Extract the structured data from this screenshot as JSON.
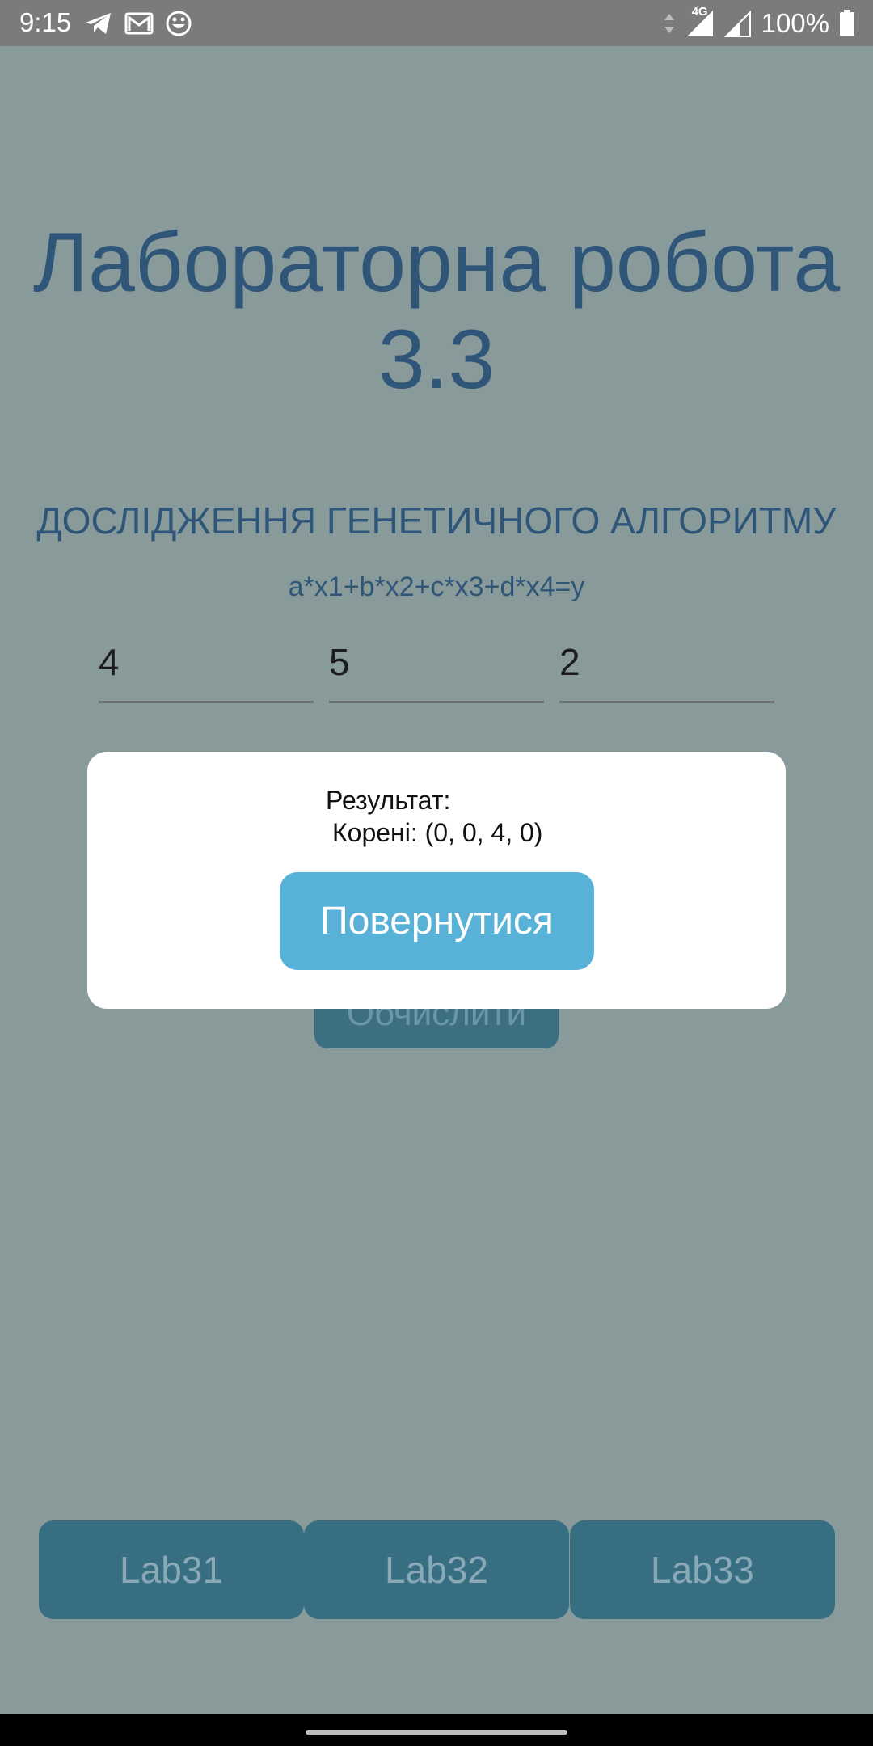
{
  "status_bar": {
    "time": "9:15",
    "network": "4G",
    "battery": "100%",
    "icons": [
      "telegram-icon",
      "gmail-icon",
      "emoji-app-icon",
      "data-arrows-icon",
      "signal-icon",
      "signal-icon",
      "battery-icon"
    ]
  },
  "screen": {
    "title_line1": "Лабораторна робота",
    "title_line2": "3.3",
    "subtitle": "ДОСЛІДЖЕННЯ ГЕНЕТИЧНОГО АЛГОРИТМУ",
    "formula": "a*x1+b*x2+c*x3+d*x4=y",
    "inputs": [
      {
        "value": "4"
      },
      {
        "value": "5"
      },
      {
        "value": "2"
      }
    ],
    "calc_button": "Обчислити"
  },
  "dialog": {
    "result_label": "Результат:",
    "roots": "Корені: (0, 0, 4, 0)",
    "return_button": "Повернутися"
  },
  "tabs": [
    "Lab31",
    "Lab32",
    "Lab33"
  ],
  "colors": {
    "background": "#889a9a",
    "title": "#2f5678",
    "button": "#376e82",
    "dialog_button": "#58b2d8"
  }
}
